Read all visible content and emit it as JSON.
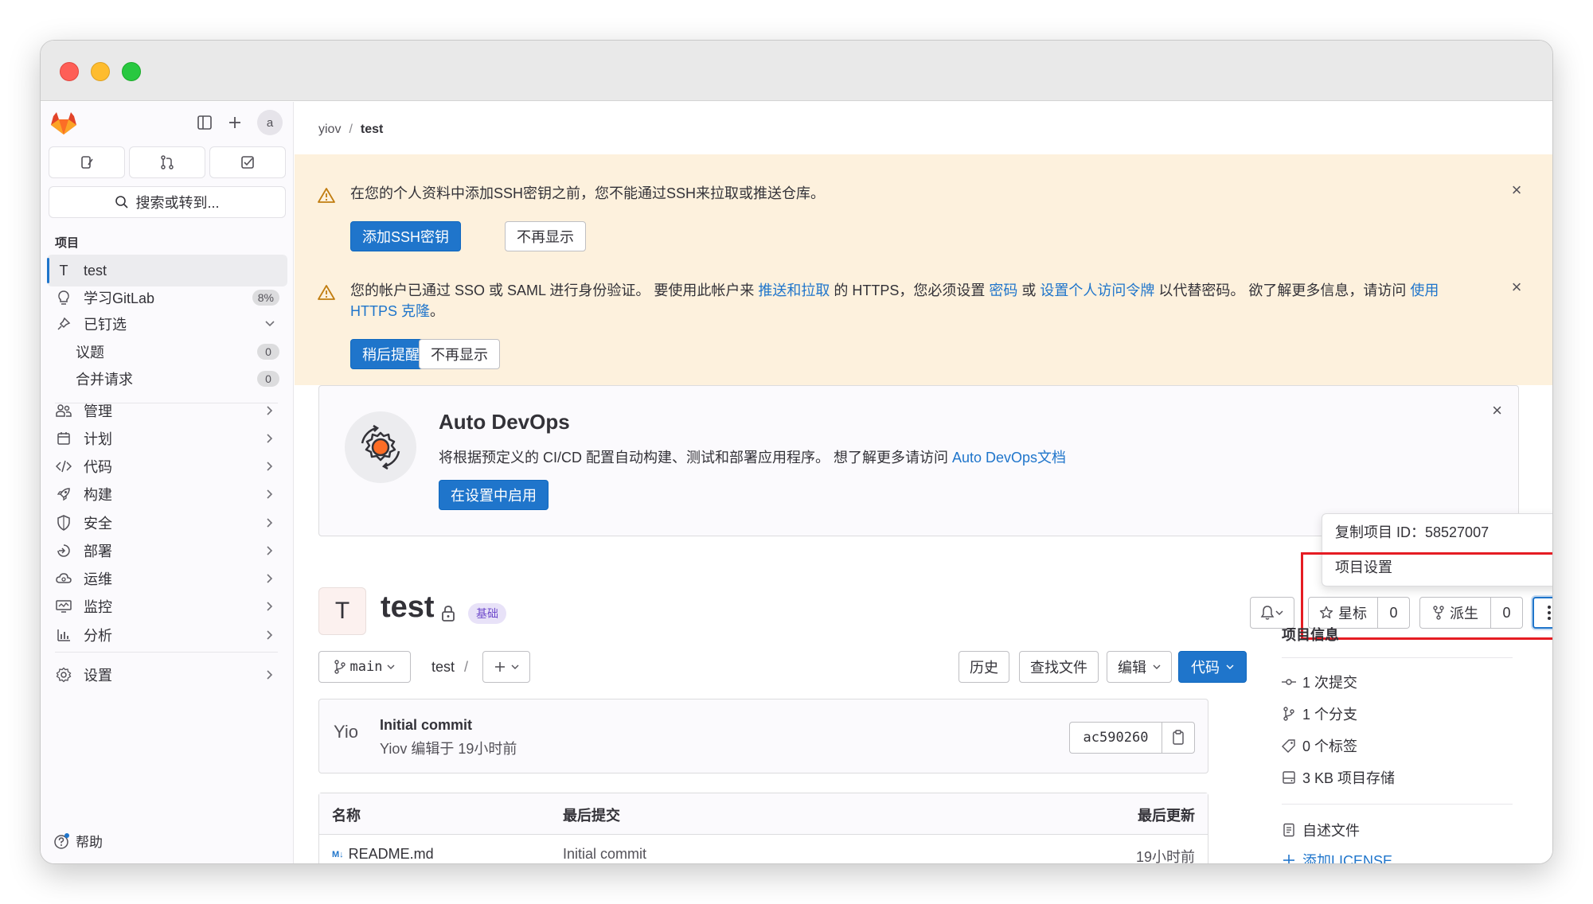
{
  "window": {
    "traffic_lights": [
      "close",
      "minimize",
      "zoom"
    ]
  },
  "sidebar": {
    "avatar_alt": "a",
    "search_label": "搜索或转到...",
    "section_title": "项目",
    "project": {
      "initial": "T",
      "label": "test"
    },
    "learn": {
      "label": "学习GitLab",
      "badge": "8%"
    },
    "pinned": {
      "label": "已钉选"
    },
    "pinned_items": [
      {
        "label": "议题",
        "count": "0"
      },
      {
        "label": "合并请求",
        "count": "0"
      }
    ],
    "nav": [
      {
        "label": "管理",
        "icon": "users-icon"
      },
      {
        "label": "计划",
        "icon": "calendar-icon"
      },
      {
        "label": "代码",
        "icon": "code-icon"
      },
      {
        "label": "构建",
        "icon": "rocket-icon"
      },
      {
        "label": "安全",
        "icon": "shield-icon"
      },
      {
        "label": "部署",
        "icon": "deploy-icon"
      },
      {
        "label": "运维",
        "icon": "cloud-icon"
      },
      {
        "label": "监控",
        "icon": "monitor-icon"
      },
      {
        "label": "分析",
        "icon": "chart-icon"
      }
    ],
    "settings": {
      "label": "设置"
    },
    "help": {
      "label": "帮助"
    }
  },
  "breadcrumb": {
    "group": "yiov",
    "separator": "/",
    "project": "test"
  },
  "alerts": [
    {
      "message": "在您的个人资料中添加SSH密钥之前，您不能通过SSH来拉取或推送仓库。",
      "primary": "添加SSH密钥",
      "secondary": "不再显示"
    },
    {
      "message_parts": [
        "您的帐户已通过 SSO 或 SAML 进行身份验证。 要使用此帐户来 ",
        "推送和拉取",
        " 的 HTTPS，您必须设置 ",
        "密码",
        " 或 ",
        "设置个人访问令牌",
        " 以代替密码。 欲了解更多信息，请访问 ",
        "使用 HTTPS 克隆",
        "。"
      ],
      "primary": "稍后提醒",
      "secondary": "不再显示"
    }
  ],
  "devops": {
    "title": "Auto DevOps",
    "description": "将根据预定义的 CI/CD 配置自动构建、测试和部署应用程序。 想了解更多请访问 ",
    "link": "Auto DevOps文档",
    "button": "在设置中启用"
  },
  "dropdown": {
    "copy_id": "复制项目 ID：58527007",
    "settings": "项目设置"
  },
  "project": {
    "initial": "T",
    "name": "test",
    "badge": "基础",
    "star_label": "星标",
    "star_count": "0",
    "fork_label": "派生",
    "fork_count": "0"
  },
  "toolbar": {
    "branch": "main",
    "path": "test",
    "path_sep": "/",
    "history": "历史",
    "find_file": "查找文件",
    "edit": "编辑",
    "code": "代码"
  },
  "commit": {
    "avatar_text": "Yio",
    "title": "Initial commit",
    "meta": "Yiov 编辑于 19小时前",
    "sha": "ac590260"
  },
  "files": {
    "headers": {
      "name": "名称",
      "last_commit": "最后提交",
      "last_update": "最后更新"
    },
    "rows": [
      {
        "name": "README.md",
        "commit": "Initial commit",
        "updated": "19小时前"
      }
    ]
  },
  "project_info": {
    "title": "项目信息",
    "commits": "1 次提交",
    "branches": "1 个分支",
    "tags": "0 个标签",
    "storage": "3 KB 项目存储",
    "readme": "自述文件",
    "add_license": "添加LICENSE"
  },
  "colors": {
    "primary": "#1f75cb",
    "alert_bg": "#fdf1dd",
    "warning": "#c17d10",
    "highlight_box": "#e51c23"
  }
}
